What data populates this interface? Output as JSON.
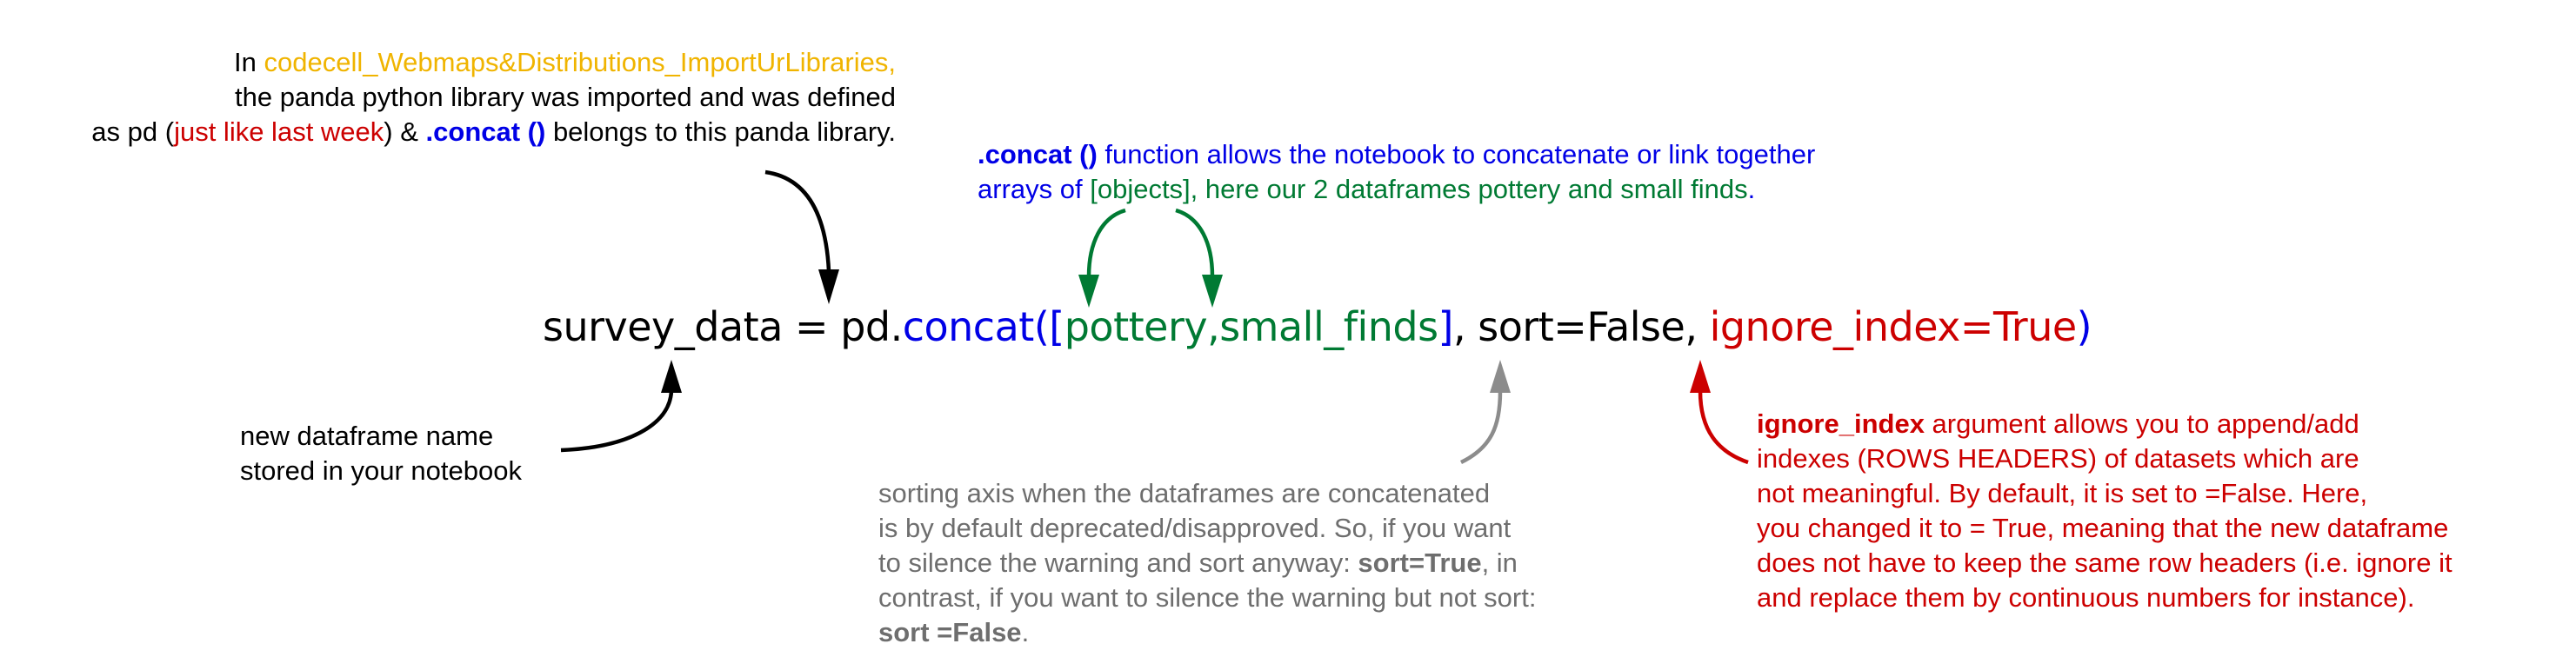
{
  "colors": {
    "black": "#000000",
    "blue": "#0000e6",
    "green": "#007a33",
    "red": "#cc0000",
    "orange": "#f0b400",
    "gray": "#6e6e6e"
  },
  "code": {
    "var": "survey_data",
    "eq": " = ",
    "module": "pd.",
    "func": "concat",
    "open": "(",
    "list_open": "[",
    "arg1": "pottery,",
    "arg2": "small_finds",
    "list_close": "]",
    "sep1": ", ",
    "sort_arg": "sort=False,",
    "sep2": " ",
    "ignore_arg": "ignore_index=True",
    "close": ")"
  },
  "note_import": {
    "l1_pre": "In ",
    "l1_cell": "codecell_Webmaps&Distributions_ImportUrLibraries,",
    "l2": "the panda python library was imported and was defined",
    "l3_pre": "as pd (",
    "l3_red": "just like last week",
    "l3_mid": ") & ",
    "l3_concat": ".concat ()",
    "l3_post": " belongs to this panda library."
  },
  "note_concat": {
    "l1_bold": ".concat ()",
    "l1_rest": " function allows the notebook to concatenate or link together",
    "l2_pre": "arrays of ",
    "l2_obj": "[objects]",
    "l2_post": ", here our 2 dataframes pottery and small finds",
    "l2_dot": "."
  },
  "note_newdf": {
    "l1": "new dataframe name",
    "l2": "stored in your notebook"
  },
  "note_sort": {
    "l1": "sorting axis when the dataframes are concatenated",
    "l2": "is by default deprecated/disapproved. So, if you want",
    "l3_pre": "to silence the warning and sort anyway: ",
    "l3_bold": "sort=True",
    "l3_post": ", in",
    "l4": "contrast, if you want to silence the warning but not sort:",
    "l5_bold": "sort =False",
    "l5_post": "."
  },
  "note_ignore": {
    "l1_bold": "ignore_index",
    "l1_rest": " argument allows you to append/add",
    "l2": "indexes (ROWS HEADERS) of datasets which are",
    "l3": "not meaningful. By default, it is set to =False. Here,",
    "l4": "you changed it to = True, meaning that the new dataframe",
    "l5": "does not have to keep the same row headers (i.e. ignore it",
    "l6": "and replace them by continuous numbers for instance)."
  }
}
